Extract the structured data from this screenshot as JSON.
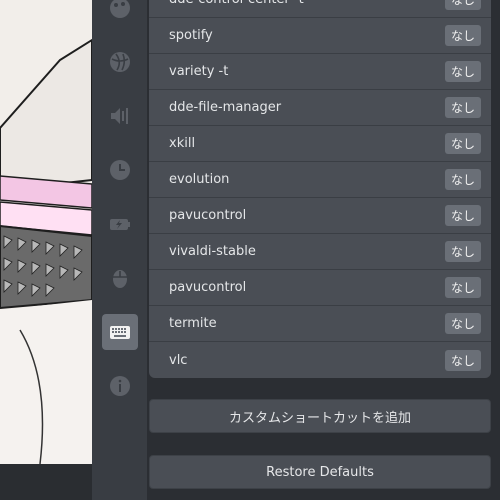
{
  "sidebar": {
    "icons": [
      {
        "name": "personalization-icon"
      },
      {
        "name": "network-icon"
      },
      {
        "name": "sound-icon"
      },
      {
        "name": "datetime-icon"
      },
      {
        "name": "power-icon"
      },
      {
        "name": "mouse-icon"
      },
      {
        "name": "keyboard-icon",
        "active": true
      },
      {
        "name": "info-icon"
      }
    ]
  },
  "shortcuts": [
    {
      "name": "dde-control-center -t",
      "key": "なし"
    },
    {
      "name": "spotify",
      "key": "なし"
    },
    {
      "name": "variety -t",
      "key": "なし"
    },
    {
      "name": "dde-file-manager",
      "key": "なし"
    },
    {
      "name": "xkill",
      "key": "なし"
    },
    {
      "name": "evolution",
      "key": "なし"
    },
    {
      "name": "pavucontrol",
      "key": "なし"
    },
    {
      "name": "vivaldi-stable",
      "key": "なし"
    },
    {
      "name": "pavucontrol",
      "key": "なし"
    },
    {
      "name": "termite",
      "key": "なし"
    },
    {
      "name": "vlc",
      "key": "なし"
    }
  ],
  "buttons": {
    "add_custom": "カスタムショートカットを追加",
    "restore_defaults": "Restore Defaults"
  }
}
